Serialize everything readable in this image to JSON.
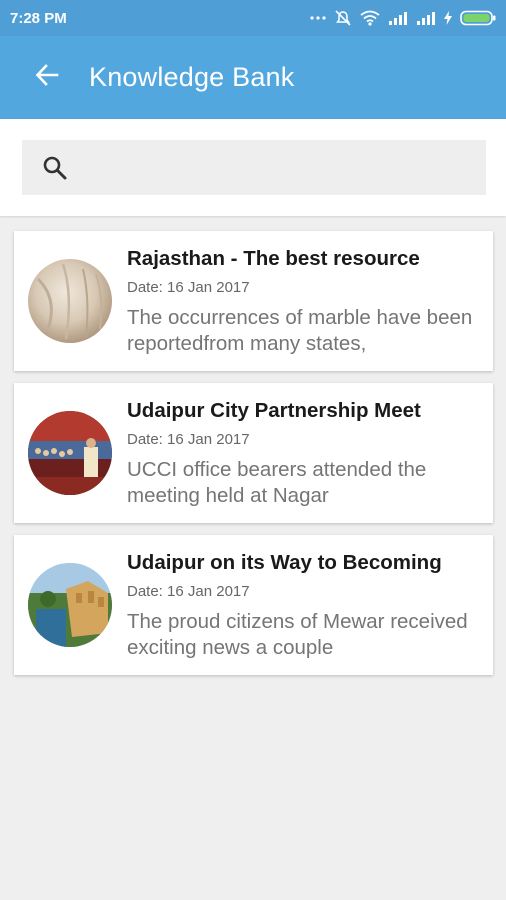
{
  "status_bar": {
    "time": "7:28 PM",
    "icons": [
      "dots-icon",
      "mute-icon",
      "wifi-icon",
      "signal-icon",
      "signal-icon",
      "charging-icon",
      "battery-icon"
    ]
  },
  "app_bar": {
    "title": "Knowledge Bank",
    "back_icon": "arrow-back-icon",
    "color": "#53a7df"
  },
  "search": {
    "placeholder": "",
    "value": "",
    "icon": "search-icon"
  },
  "articles": [
    {
      "title": "Rajasthan - The best resource",
      "date": "Date: 16 Jan 2017",
      "description": "The occurrences of marble have been reportedfrom many states,",
      "thumbnail": "marble-photo"
    },
    {
      "title": "Udaipur City Partnership Meet",
      "date": "Date: 16 Jan 2017",
      "description": "UCCI office bearers attended the meeting held at Nagar",
      "thumbnail": "meeting-photo"
    },
    {
      "title": "Udaipur on its Way to Becoming",
      "date": "Date: 16 Jan 2017",
      "description": "The proud citizens of Mewar received exciting news a couple",
      "thumbnail": "city-palace-photo"
    }
  ]
}
